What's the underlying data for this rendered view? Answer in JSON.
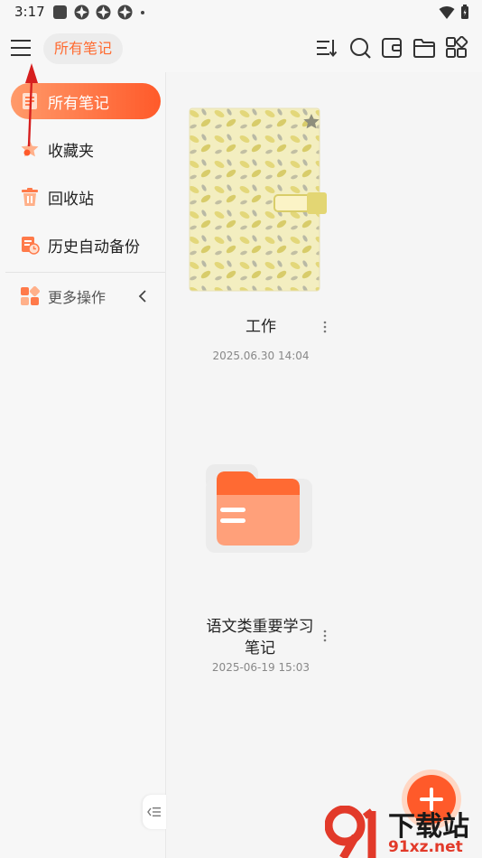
{
  "status_bar": {
    "time": "3:17"
  },
  "header": {
    "title": "所有笔记"
  },
  "sidebar": {
    "items": [
      {
        "label": "所有笔记"
      },
      {
        "label": "收藏夹"
      },
      {
        "label": "回收站"
      },
      {
        "label": "历史自动备份"
      }
    ],
    "more_label": "更多操作"
  },
  "notes": [
    {
      "title": "工作",
      "date": "2025.06.30 14:04"
    },
    {
      "title_line1": "语文类重要学习",
      "title_line2": "笔记",
      "date": "2025-06-19 15:03"
    }
  ],
  "watermark": {
    "brand": "下载站",
    "site": "91xz.net"
  },
  "colors": {
    "accent": "#ff6a2f",
    "fab": "#ff5a2a",
    "folder": "#ff7a4a"
  }
}
